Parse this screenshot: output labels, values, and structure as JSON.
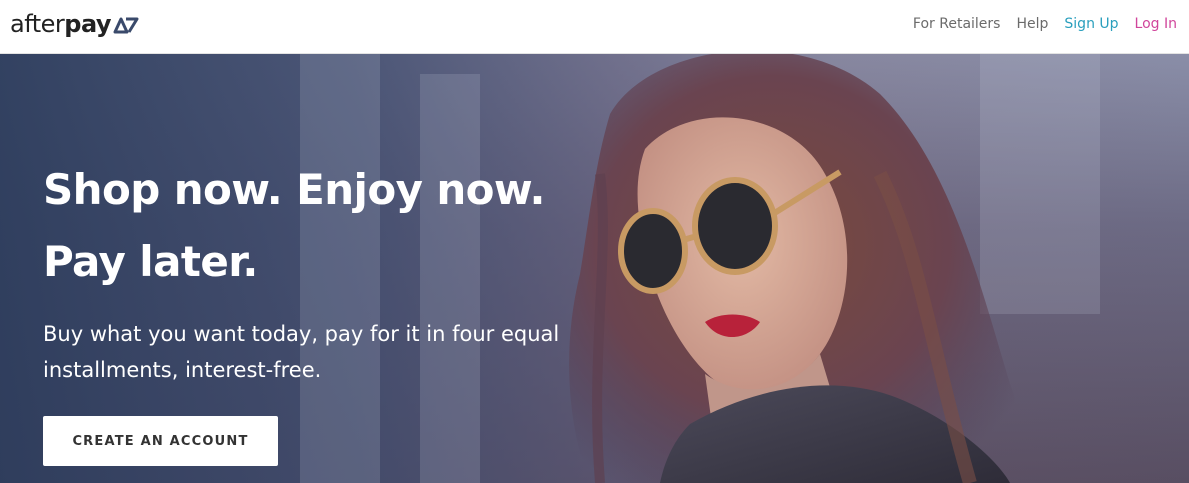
{
  "header": {
    "logo": {
      "text_regular": "after",
      "text_bold": "pay",
      "mark_color": "#3a4a6b"
    },
    "nav": {
      "retailers": "For Retailers",
      "help": "Help",
      "signup": "Sign Up",
      "login": "Log In"
    },
    "colors": {
      "signup": "#2a9fbd",
      "login": "#d0459b"
    }
  },
  "hero": {
    "headline_line1": "Shop now. Enjoy now.",
    "headline_line2": "Pay later.",
    "subtext": "Buy what you want today, pay for it in four equal installments, interest-free.",
    "cta_label": "CREATE AN ACCOUNT"
  }
}
